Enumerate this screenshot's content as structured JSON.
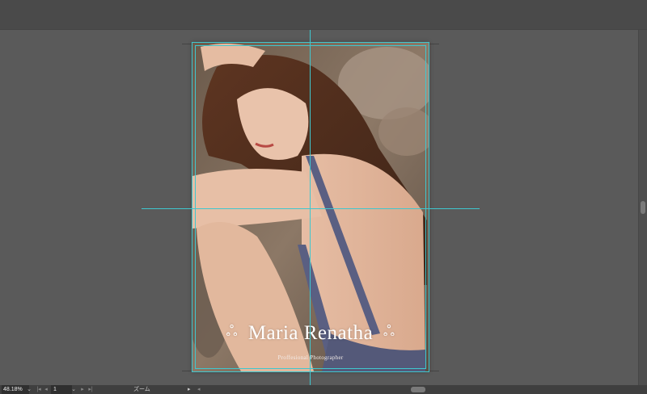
{
  "document": {
    "title": "Maria Renatha",
    "subtitle": "Proffesional Photographer",
    "ornament_left": "ஃ",
    "ornament_right": "ஃ"
  },
  "status_bar": {
    "zoom_value": "48.18%",
    "page_value": "1",
    "status_label": "ズーム",
    "dropdown_glyph": "⌄",
    "first_glyph": "|◂",
    "prev_glyph": "◂",
    "next_glyph": "▸",
    "last_glyph": "▸|",
    "status_arrow_glyph": "▸",
    "scroll_left_glyph": "◂"
  },
  "colors": {
    "canvas": "#5a5a5a",
    "guide": "#3fc7cf",
    "title_text": "#ffffff"
  },
  "icons": [
    "dropdown-chevron-icon",
    "first-page-icon",
    "previous-page-icon",
    "next-page-icon",
    "last-page-icon",
    "status-menu-arrow-icon",
    "scroll-left-arrow-icon"
  ]
}
